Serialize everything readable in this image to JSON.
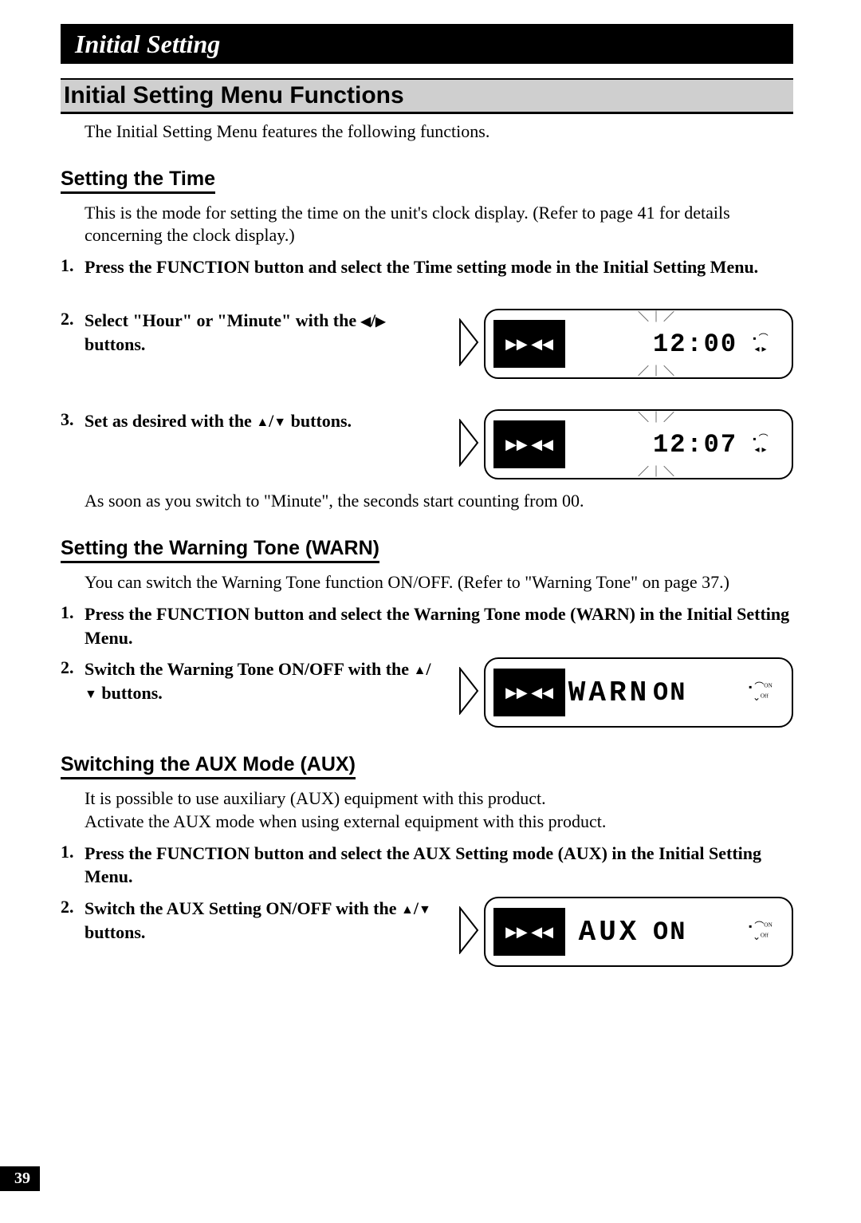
{
  "header": "Initial Setting",
  "h1": "Initial Setting Menu Functions",
  "intro": "The Initial Setting Menu features the following functions.",
  "page_number": "39",
  "glyph": {
    "left": "◀",
    "right": "▶",
    "up": "▲",
    "down": "▼",
    "slash": "/"
  },
  "section_time": {
    "title": "Setting the Time",
    "intro": "This is the mode for setting the time on the unit's clock display. (Refer to page 41 for details concerning the clock display.)",
    "step1": "Press the FUNCTION button and select the Time setting mode in the Initial Setting Menu.",
    "step2_pre": "Select \"Hour\" or \"Minute\" with the ",
    "step2_post": " buttons.",
    "step3_pre": "Set as desired with the ",
    "step3_post": " buttons.",
    "lcd2": {
      "main": "",
      "value": "12:00"
    },
    "lcd3": {
      "main": "",
      "value": "12:07"
    },
    "note": "As soon as you switch to \"Minute\", the seconds start counting from 00."
  },
  "section_warn": {
    "title": "Setting the Warning Tone (WARN)",
    "intro": "You can switch the Warning Tone function ON/OFF. (Refer to \"Warning Tone\" on page 37.)",
    "step1": "Press the FUNCTION button and select the Warning Tone mode (WARN) in the Initial Setting Menu.",
    "step2_pre": "Switch the Warning Tone ON/OFF with the ",
    "step2_post": " buttons.",
    "lcd": {
      "main": "WARN",
      "value": "ON"
    }
  },
  "section_aux": {
    "title": "Switching the AUX Mode (AUX)",
    "intro_line1": "It is possible to use auxiliary (AUX) equipment with this product.",
    "intro_line2": "Activate the AUX mode when using external equipment with this product.",
    "step1": "Press the FUNCTION button and select the AUX Setting mode (AUX) in the Initial Setting Menu.",
    "step2_pre": "Switch the AUX Setting ON/OFF with the ",
    "step2_post": " buttons.",
    "lcd": {
      "main": "AUX",
      "value": "ON"
    }
  }
}
